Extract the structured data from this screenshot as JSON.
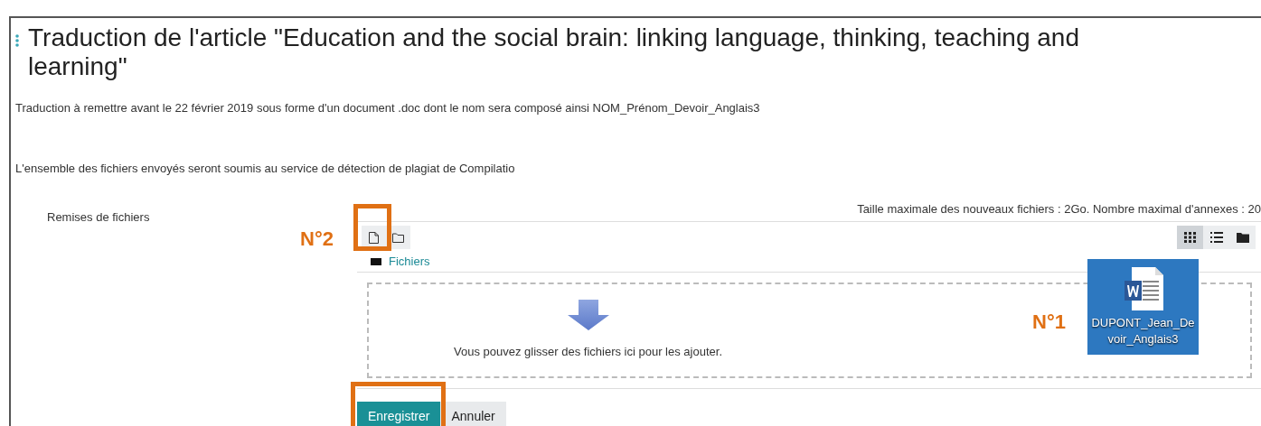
{
  "heading": "Traduction de l'article \"Education and the social brain: linking language, thinking, teaching and learning\"",
  "paragraphs": [
    "Traduction à remettre avant le 22 février 2019 sous forme d'un document .doc dont le nom sera composé ainsi NOM_Prénom_Devoir_Anglais3",
    "L'ensemble des fichiers envoyés seront soumis au service de détection de plagiat de Compilatio"
  ],
  "file_field": {
    "label": "Remises de fichiers",
    "limits": "Taille maximale des nouveaux fichiers : 2Go. Nombre maximal d'annexes : 20",
    "view_modes": [
      {
        "kind": "icons",
        "selected": true
      },
      {
        "kind": "list",
        "selected": false
      },
      {
        "kind": "tree",
        "selected": false
      }
    ],
    "folder_link": "Fichiers",
    "drop_hint": "Vous pouvez glisser des fichiers ici pour les ajouter."
  },
  "buttons": [
    {
      "label": "Enregistrer",
      "kind": "primary"
    },
    {
      "label": "Annuler",
      "kind": "secondary"
    }
  ],
  "desktop_file": {
    "name": "DUPONT_Jean_Devoir_Anglais3"
  },
  "annotations": [
    {
      "label": "N°1"
    },
    {
      "label": "N°2"
    }
  ]
}
